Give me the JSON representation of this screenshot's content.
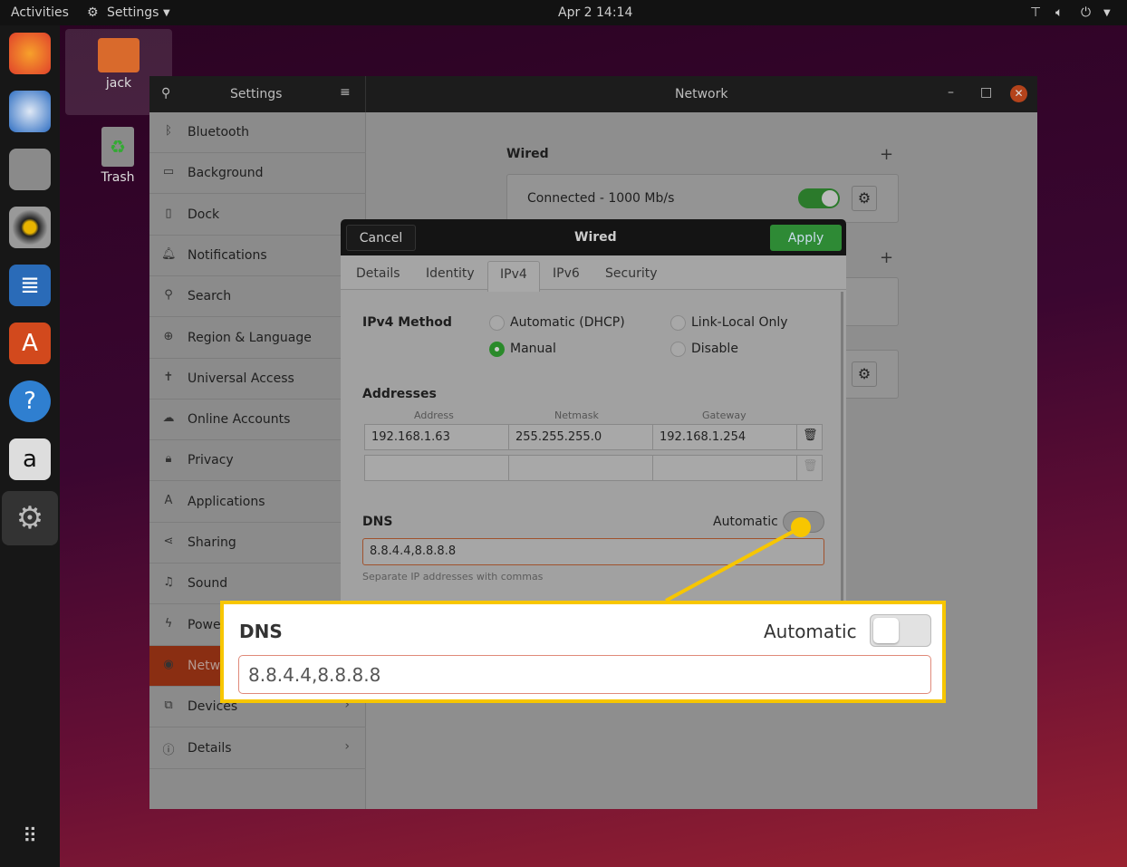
{
  "topbar": {
    "activities": "Activities",
    "app_menu": "Settings",
    "clock": "Apr 2  14:14"
  },
  "desktop": {
    "home_label": "jack",
    "trash_label": "Trash"
  },
  "dock": [
    "firefox-icon",
    "thunderbird-icon",
    "files-icon",
    "rhythmbox-icon",
    "libreoffice-writer-icon",
    "software-center-icon",
    "help-icon",
    "amazon-icon",
    "settings-icon",
    "show-apps-icon"
  ],
  "settings": {
    "title": "Settings",
    "panel_title": "Network",
    "sidebar": [
      {
        "label": "Bluetooth",
        "icon": "bluetooth-icon"
      },
      {
        "label": "Background",
        "icon": "background-icon"
      },
      {
        "label": "Dock",
        "icon": "dock-icon"
      },
      {
        "label": "Notifications",
        "icon": "bell-icon"
      },
      {
        "label": "Search",
        "icon": "search-icon"
      },
      {
        "label": "Region & Language",
        "icon": "globe-icon"
      },
      {
        "label": "Universal Access",
        "icon": "accessibility-icon"
      },
      {
        "label": "Online Accounts",
        "icon": "cloud-icon"
      },
      {
        "label": "Privacy",
        "icon": "lock-icon"
      },
      {
        "label": "Applications",
        "icon": "applications-icon"
      },
      {
        "label": "Sharing",
        "icon": "share-icon"
      },
      {
        "label": "Sound",
        "icon": "music-note-icon"
      },
      {
        "label": "Power",
        "icon": "power-icon"
      },
      {
        "label": "Network",
        "icon": "network-icon",
        "selected": true
      },
      {
        "label": "Devices",
        "icon": "devices-icon"
      },
      {
        "label": "Details",
        "icon": "info-icon"
      }
    ],
    "wired": {
      "heading": "Wired",
      "status": "Connected - 1000 Mb/s",
      "enabled": true
    }
  },
  "dialog": {
    "title": "Wired",
    "cancel": "Cancel",
    "apply": "Apply",
    "tabs": [
      "Details",
      "Identity",
      "IPv4",
      "IPv6",
      "Security"
    ],
    "active_tab": "IPv4",
    "method_label": "IPv4 Method",
    "methods": [
      {
        "label": "Automatic (DHCP)",
        "checked": false
      },
      {
        "label": "Link-Local Only",
        "checked": false
      },
      {
        "label": "Manual",
        "checked": true
      },
      {
        "label": "Disable",
        "checked": false
      }
    ],
    "addresses_label": "Addresses",
    "columns": [
      "Address",
      "Netmask",
      "Gateway"
    ],
    "rows": [
      [
        "192.168.1.63",
        "255.255.255.0",
        "192.168.1.254"
      ],
      [
        "",
        "",
        ""
      ]
    ],
    "dns_label": "DNS",
    "dns_auto_label": "Automatic",
    "dns_auto": false,
    "dns_value": "8.8.4.4,8.8.8.8",
    "dns_hint": "Separate IP addresses with commas"
  },
  "colors": {
    "accent": "#e95420",
    "apply": "#2e9a3a",
    "callout": "#f7c600"
  }
}
